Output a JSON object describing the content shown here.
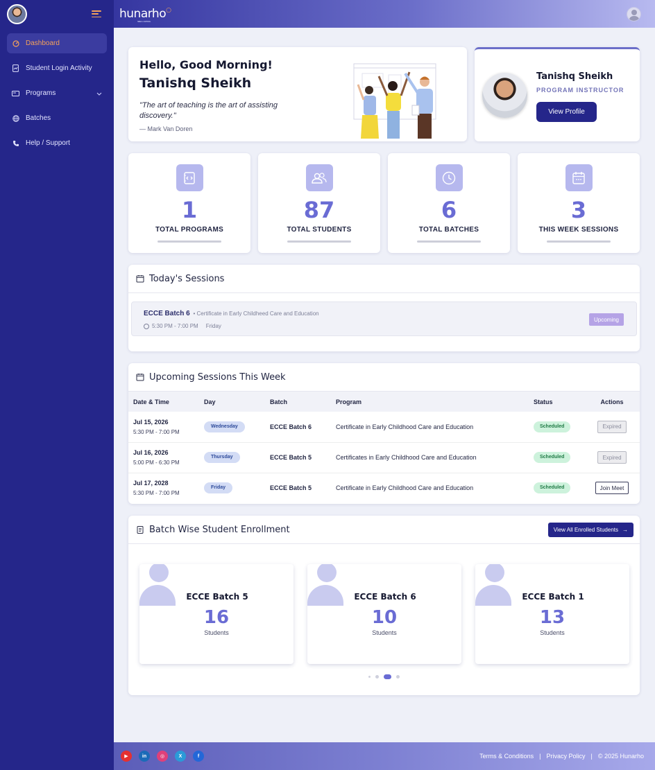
{
  "header": {
    "logo": "hunarho",
    "logo_sub": "SKILLS • SCHOOL"
  },
  "sidebar": {
    "items": [
      {
        "label": "Dashboard",
        "icon": "dashboard-icon"
      },
      {
        "label": "Student Login Activity",
        "icon": "document-icon"
      },
      {
        "label": "Programs",
        "icon": "card-icon"
      },
      {
        "label": "Batches",
        "icon": "globe-icon"
      },
      {
        "label": "Help / Support",
        "icon": "phone-icon"
      }
    ]
  },
  "greeting": {
    "hello": "Hello, Good Morning!",
    "name": "Tanishq Sheikh",
    "quote": "\"The art of teaching is the art of assisting discovery.\"",
    "author": "— Mark Van Doren"
  },
  "profile": {
    "name": "Tanishq Sheikh",
    "role": "PROGRAM INSTRUCTOR",
    "button": "View Profile"
  },
  "stats": [
    {
      "value": "1",
      "label": "TOTAL PROGRAMS",
      "icon": "code-file-icon"
    },
    {
      "value": "87",
      "label": "TOTAL STUDENTS",
      "icon": "users-icon"
    },
    {
      "value": "6",
      "label": "TOTAL BATCHES",
      "icon": "clock-icon"
    },
    {
      "value": "3",
      "label": "THIS WEEK SESSIONS",
      "icon": "calendar-icon"
    }
  ],
  "today": {
    "title": "Today's Sessions",
    "session": {
      "batch": "ECCE Batch 6",
      "program": "• Certificate in Early Childheed Care and Education",
      "time": "5:30 PM - 7:00 PM",
      "day": "Friday",
      "badge": "Upcoming"
    }
  },
  "week": {
    "title": "Upcoming Sessions This Week",
    "columns": [
      "Date & Time",
      "Day",
      "Batch",
      "Program",
      "Status",
      "Actions"
    ],
    "rows": [
      {
        "date": "Jul 15, 2026",
        "time": "5:30 PM - 7:00 PM",
        "day": "Wednesday",
        "batch": "ECCE Batch 6",
        "program": "Certificate in Early Childhood Care and Education",
        "status": "Scheduled",
        "action": "Expired"
      },
      {
        "date": "Jul 16, 2026",
        "time": "5:00 PM - 6:30 PM",
        "day": "Thursday",
        "batch": "ECCE Batch 5",
        "program": "Certificates in Early Childhood Care and Education",
        "status": "Scheduled",
        "action": "Expired"
      },
      {
        "date": "Jul 17, 2028",
        "time": "5:30 PM - 7:00 PM",
        "day": "Friday",
        "batch": "ECCE Batch 5",
        "program": "Certificate in Early Childhood Care and Education",
        "status": "Scheduled",
        "action": "Join Meet"
      }
    ]
  },
  "enrollment": {
    "title": "Batch Wise Student Enrollment",
    "button": "View All Enrolled Students",
    "cards": [
      {
        "name": "ECCE Batch 5",
        "count": "16",
        "unit": "Students"
      },
      {
        "name": "ECCE Batch 6",
        "count": "10",
        "unit": "Students"
      },
      {
        "name": "ECCE Batch 1",
        "count": "13",
        "unit": "Students"
      }
    ]
  },
  "footer": {
    "socials": [
      "youtube-icon",
      "linkedin-icon",
      "instagram-icon",
      "x-icon",
      "facebook-icon"
    ],
    "links": [
      "Terms & Conditions",
      "Privacy Policy",
      "© 2025 Hunarho"
    ]
  }
}
